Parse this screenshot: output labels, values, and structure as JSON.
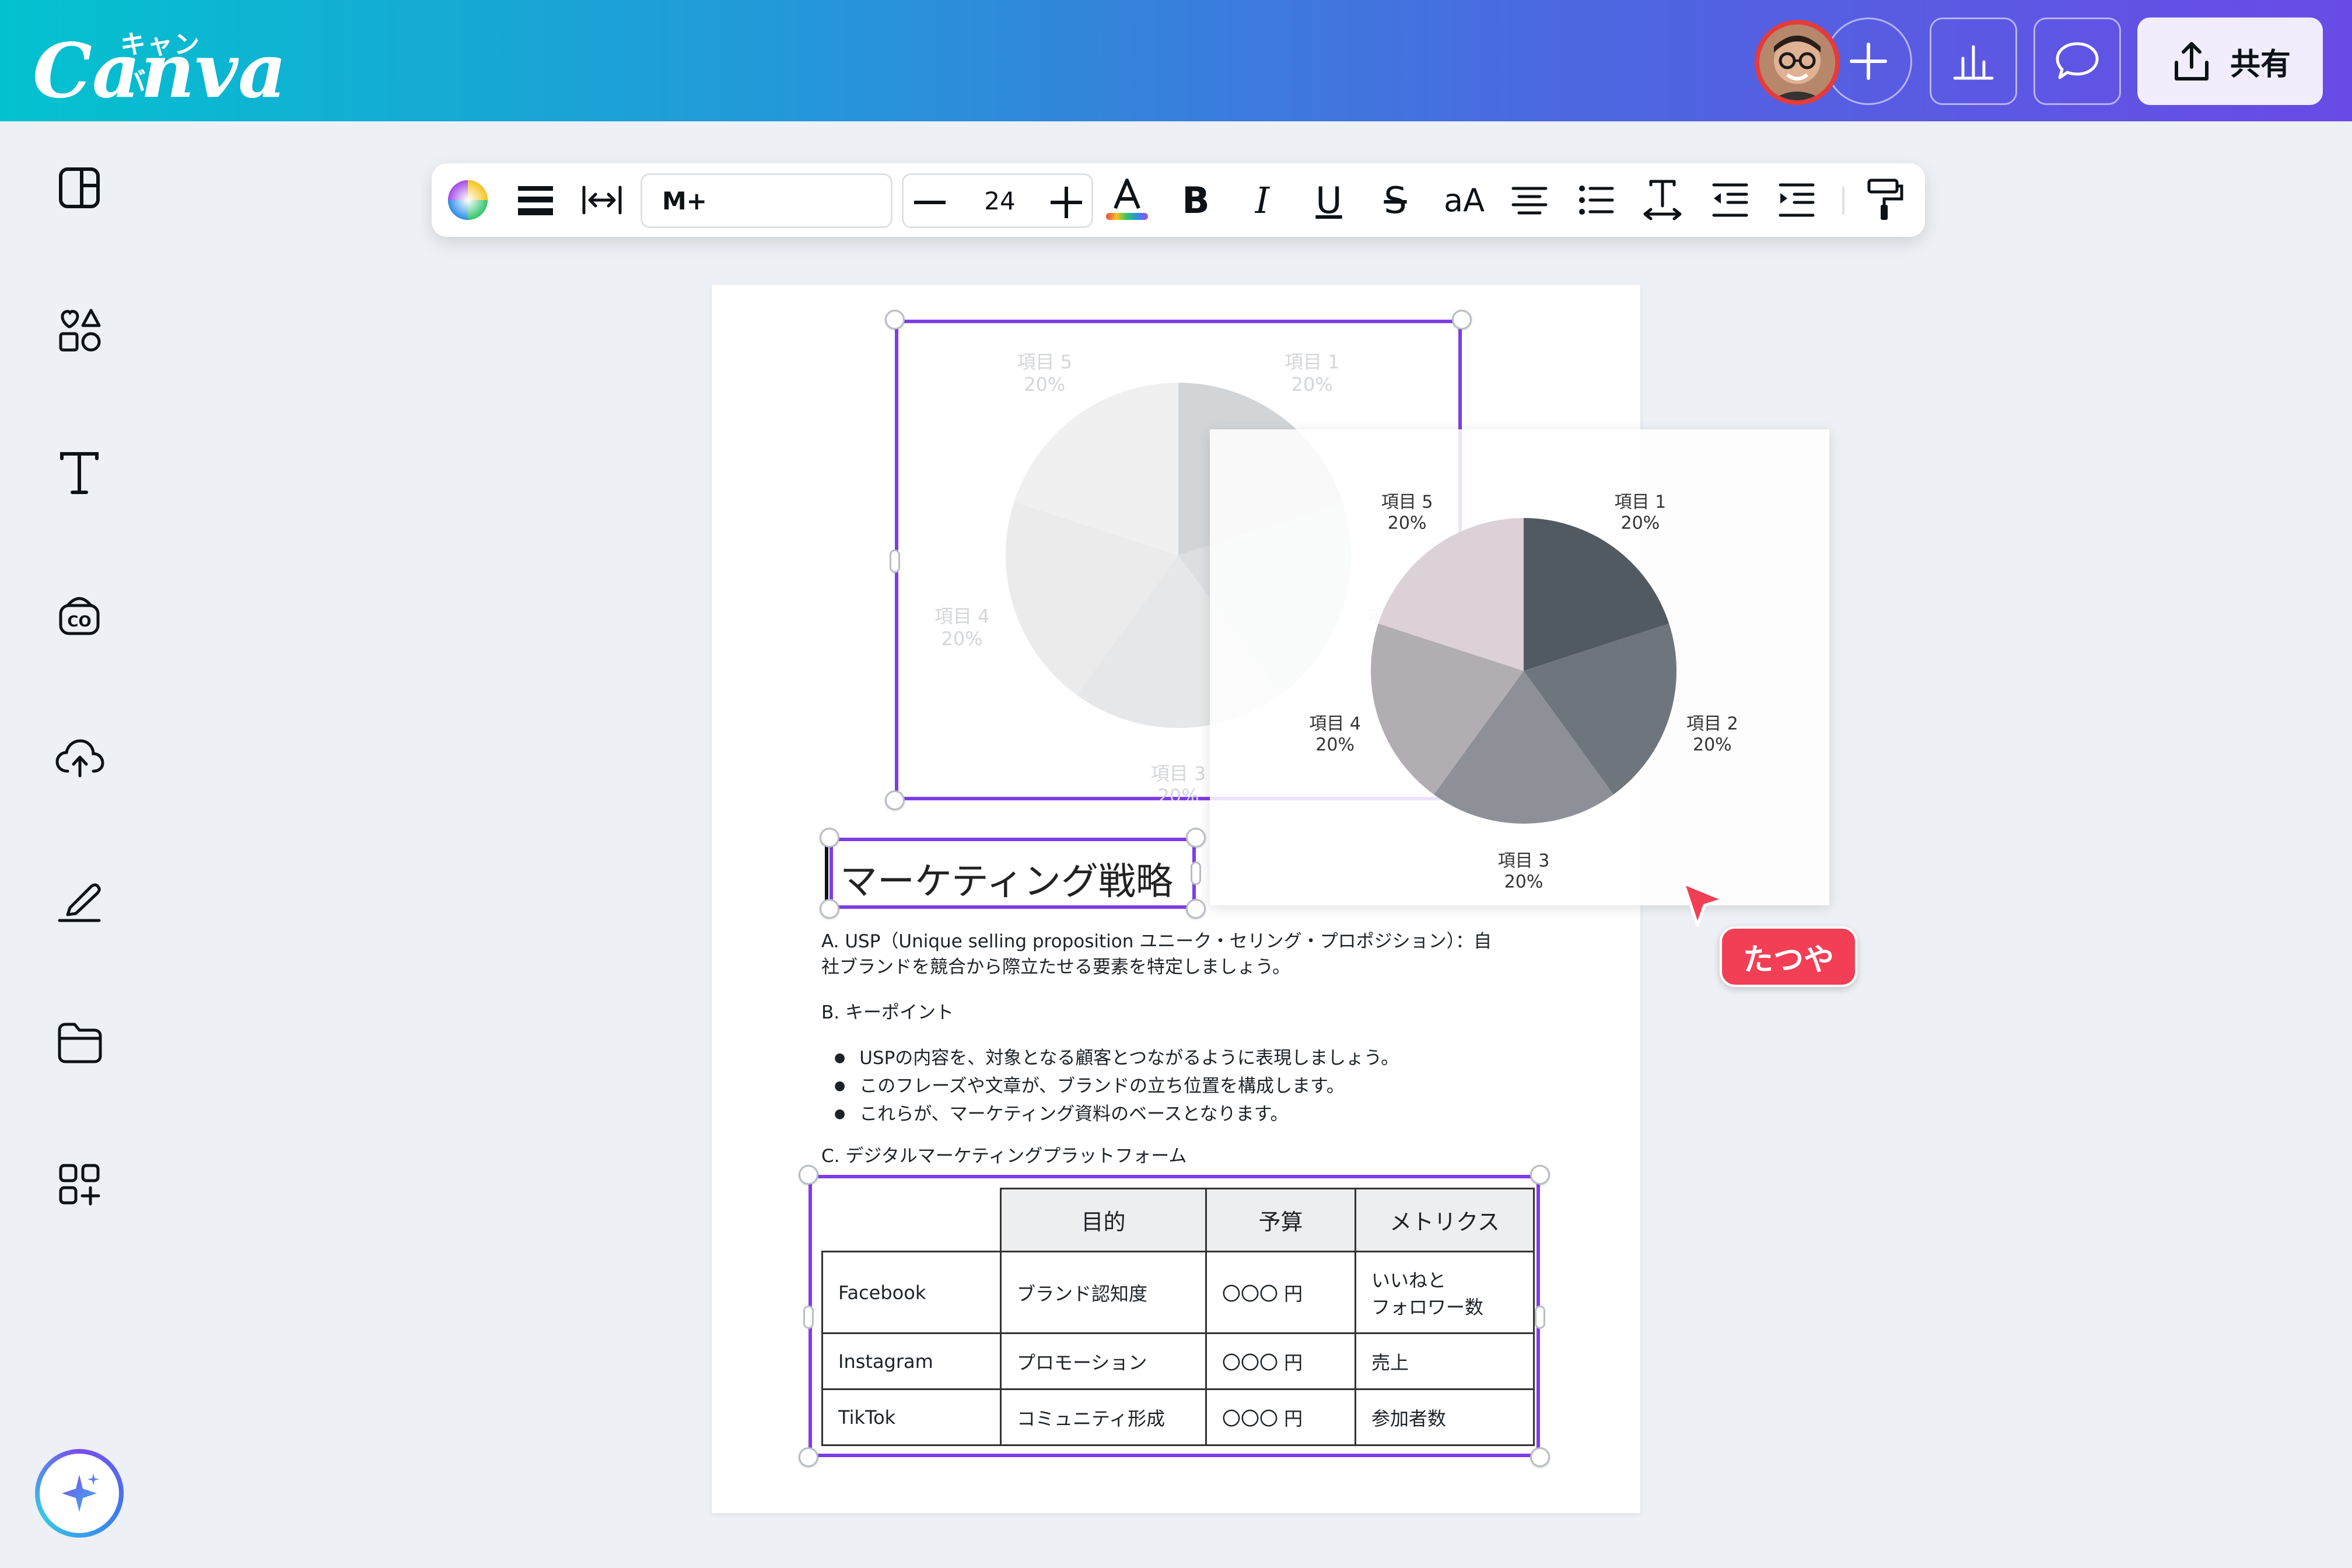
{
  "app": {
    "logo_kana": "キャンバ",
    "logo_word": "Canva",
    "share_label": "共有",
    "accent": "#7d3ee8"
  },
  "header_icons": [
    "avatar",
    "plus-icon",
    "chart-icon",
    "comment-icon",
    "share-icon"
  ],
  "sidebar": {
    "icons": [
      "layout-icon",
      "elements-icon",
      "text-icon",
      "brand-icon",
      "upload-icon",
      "draw-icon",
      "folder-icon",
      "apps-icon",
      "magic-icon"
    ]
  },
  "toolbar": {
    "font_name": "M+",
    "font_size": "24",
    "bold_label": "B",
    "italic_label": "I",
    "underline_label": "U",
    "strike_label": "S",
    "case_label": "aA"
  },
  "document": {
    "heading": "マーケティング戦略",
    "para_a": "A. USP（Unique selling proposition ユニーク・セリング・プロポジション）：自",
    "para_a2": "社ブランドを競合から際立たせる要素を特定しましょう。",
    "para_b": "B. キーポイント",
    "bullets": [
      "USPの内容を、対象となる顧客とつながるように表現しましょう。",
      "このフレーズや文章が、ブランドの立ち位置を構成します。",
      "これらが、マーケティング資料のベースとなります。"
    ],
    "para_c": "C. デジタルマーケティングプラットフォーム",
    "table": {
      "headers": [
        "目的",
        "予算",
        "メトリクス"
      ],
      "rows": [
        {
          "platform": "Facebook",
          "purpose": "ブランド認知度",
          "budget": "〇〇〇 円",
          "metric1": "いいねと",
          "metric2": "フォロワー数"
        },
        {
          "platform": "Instagram",
          "purpose": "プロモーション",
          "budget": "〇〇〇 円",
          "metric1": "売上",
          "metric2": ""
        },
        {
          "platform": "TikTok",
          "purpose": "コミュニティ形成",
          "budget": "〇〇〇 円",
          "metric1": "参加者数",
          "metric2": ""
        }
      ]
    }
  },
  "chart_data": [
    {
      "type": "pie",
      "categories": [
        "項目 1",
        "項目 2",
        "項目 3",
        "項目 4",
        "項目 5"
      ],
      "values": [
        20,
        20,
        20,
        20,
        20
      ],
      "value_labels": [
        "20%",
        "20%",
        "20%",
        "20%",
        "20%"
      ],
      "colors": [
        "#525a61",
        "#6f757d",
        "#8d9097",
        "#b1adb3",
        "#dbd1d7"
      ],
      "legend": "none"
    },
    {
      "type": "pie",
      "categories": [
        "項目 1",
        "項目 2",
        "項目 3",
        "項目 4",
        "項目 5"
      ],
      "values": [
        20,
        20,
        20,
        20,
        20
      ],
      "value_labels": [
        "20%",
        "20%",
        "20%",
        "20%",
        "20%"
      ],
      "colors": [
        "#d2d5d7",
        "#dcdfe1",
        "#e6e7e8",
        "#ebebeb",
        "#f0f0f0"
      ],
      "legend": "none"
    }
  ],
  "collaborator": {
    "name": "たつや",
    "color": "#f23f55"
  }
}
